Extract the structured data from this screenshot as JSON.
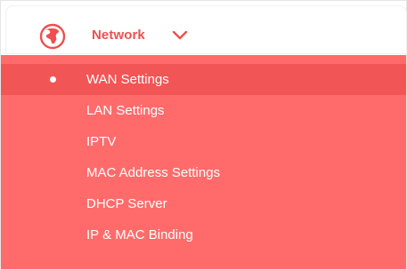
{
  "header": {
    "title": "Network",
    "icon": "globe-icon",
    "expand_icon": "chevron-down-icon"
  },
  "colors": {
    "accent": "#ef4f4f",
    "menu_bg": "#ff6b6b",
    "active_bg": "#f25555"
  },
  "menu": {
    "items": [
      {
        "label": "WAN Settings",
        "active": true
      },
      {
        "label": "LAN Settings"
      },
      {
        "label": "IPTV"
      },
      {
        "label": "MAC Address Settings"
      },
      {
        "label": "DHCP Server"
      },
      {
        "label": "IP & MAC Binding"
      }
    ]
  }
}
